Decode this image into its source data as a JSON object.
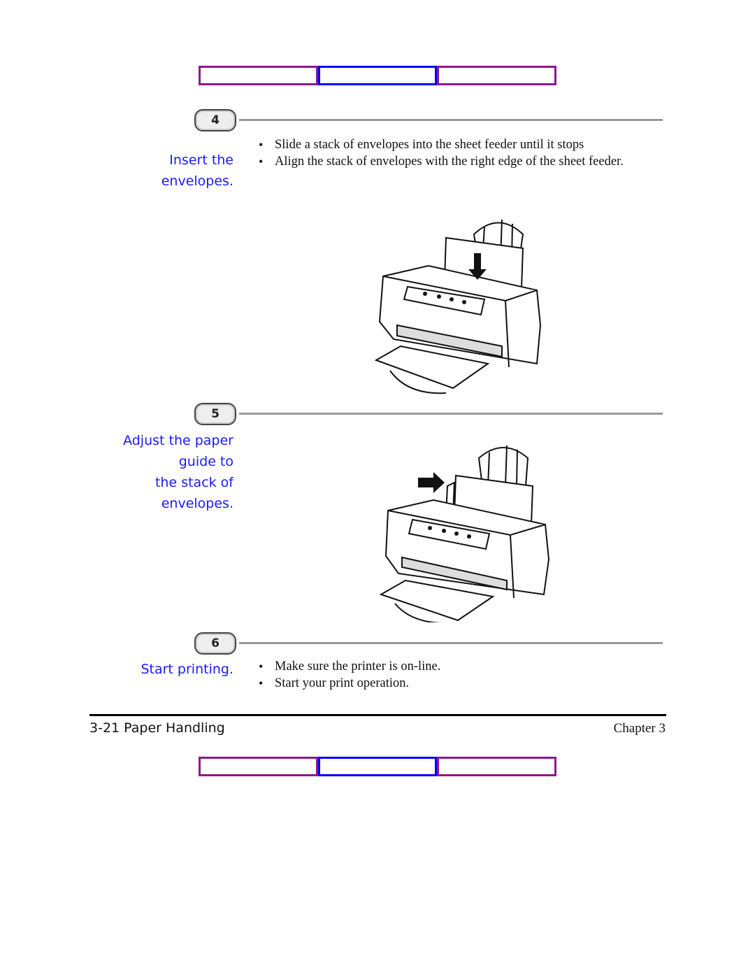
{
  "nav_top": {
    "buttons": [
      "",
      "",
      ""
    ]
  },
  "nav_bottom": {
    "buttons": [
      "",
      "",
      ""
    ]
  },
  "steps": [
    {
      "number": "4",
      "caption": [
        "Insert the",
        "envelopes."
      ],
      "bullets": [
        "Slide a stack of envelopes into the sheet feeder until it stops",
        "Align the stack of envelopes with the right edge of the sheet feeder."
      ],
      "illustration": "printer-inserting-envelopes-down-arrow"
    },
    {
      "number": "5",
      "caption": [
        "Adjust the paper",
        "guide to",
        "the stack of",
        "envelopes."
      ],
      "bullets": [],
      "illustration": "printer-adjust-paper-guide-right-arrow"
    },
    {
      "number": "6",
      "caption": [
        "Start printing."
      ],
      "bullets": [
        "Make sure the printer is on-line.",
        "Start your print operation."
      ]
    }
  ],
  "footer": {
    "page_label": "3-21 Paper Handling",
    "chapter": "Chapter 3"
  },
  "colors": {
    "caption": "#1a1aff",
    "nav_outer": "#8b1a8b",
    "nav_middle": "#0000ff"
  }
}
